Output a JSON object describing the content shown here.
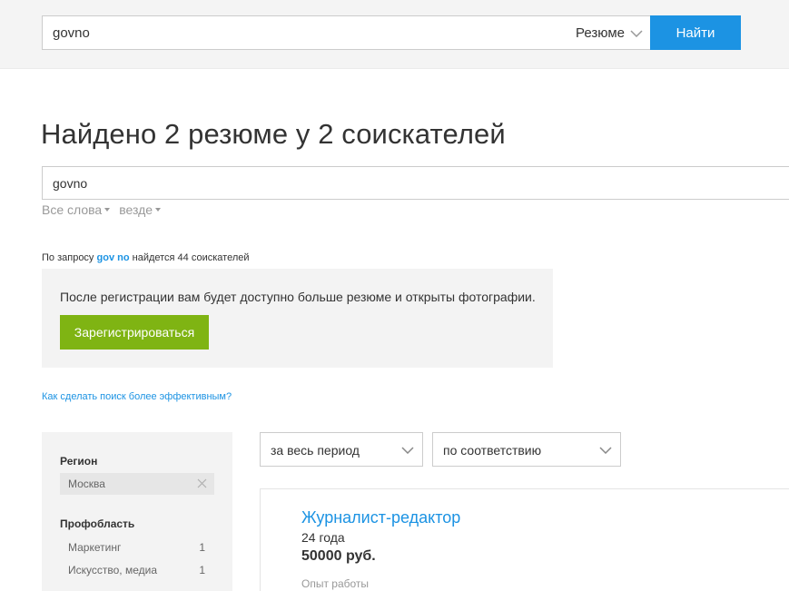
{
  "header": {
    "search_value": "govno",
    "search_type": "Резюме",
    "find_button": "Найти"
  },
  "page_title": "Найдено 2 резюме у 2 соискателей",
  "query": {
    "value": "govno",
    "words_filter": "Все слова",
    "area_filter": "везде"
  },
  "hint": {
    "prefix": "По запросу",
    "query": "gov no",
    "suffix": "найдется 44 соискателей"
  },
  "registration": {
    "text": "После регистрации вам будет доступно больше резюме и открыты фотографии.",
    "button": "Зарегистрироваться"
  },
  "help_link": "Как сделать поиск более эффективным?",
  "sidebar": {
    "region_heading": "Регион",
    "region_value": "Москва",
    "profarea_heading": "Профобласть",
    "profareas": [
      {
        "label": "Маркетинг",
        "count": "1"
      },
      {
        "label": "Искусство, медиа",
        "count": "1"
      }
    ]
  },
  "sorting": {
    "period": "за весь период",
    "order": "по соответствию"
  },
  "result": {
    "title": "Журналист-редактор",
    "age": "24 года",
    "salary": "50000 руб.",
    "experience_label": "Опыт работы"
  },
  "colors": {
    "accent_blue": "#1c93e3",
    "register_green": "#7fb413",
    "panel_gray": "#f3f3f3"
  }
}
